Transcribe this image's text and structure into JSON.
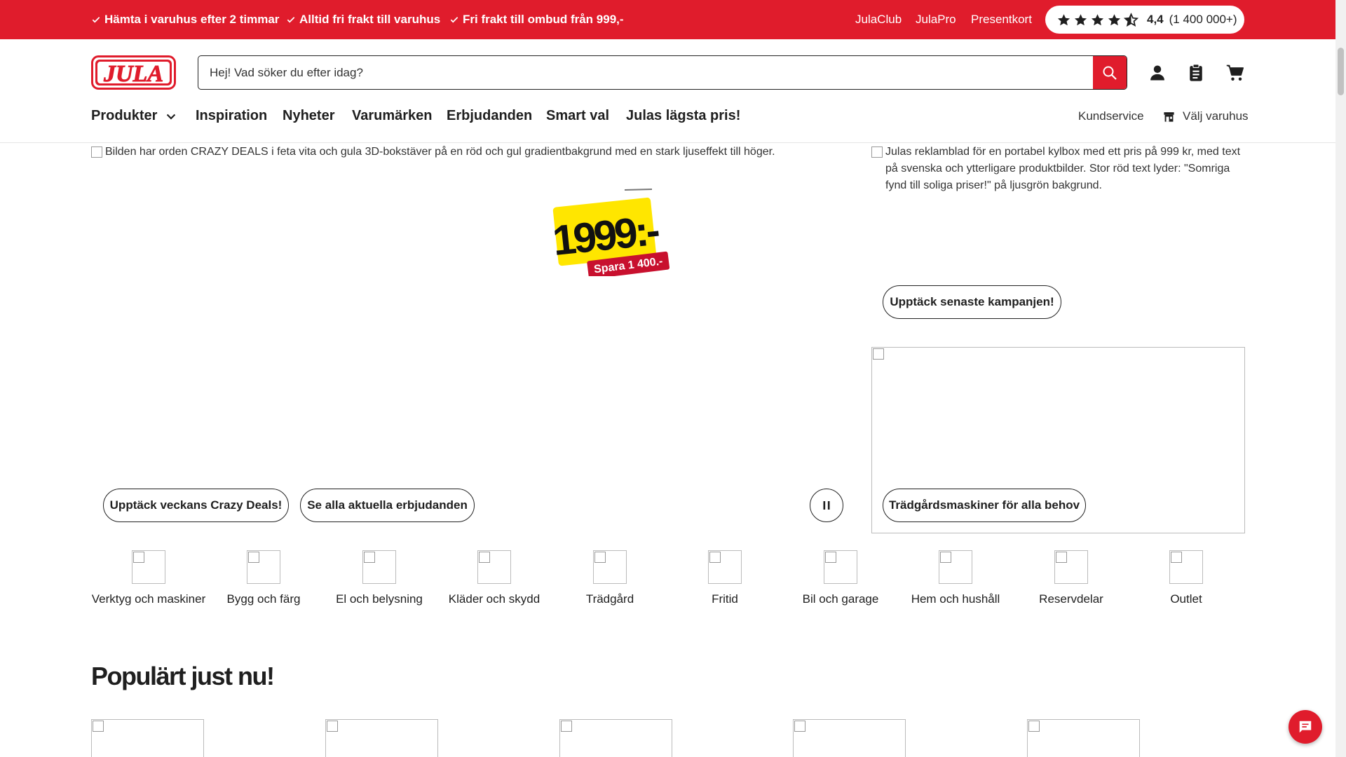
{
  "colors": {
    "brand_red": "#e01c2c",
    "text": "#1f1f1f"
  },
  "topbar": {
    "usps": [
      "Hämta i varuhus efter 2 timmar",
      "Alltid fri frakt till varuhus",
      "Fri frakt till ombud från 999,-"
    ],
    "links": [
      "JulaClub",
      "JulaPro",
      "Presentkort"
    ],
    "rating": {
      "score": "4,4",
      "count": "(1 400 000+)",
      "stars": 4.5,
      "max": 5
    }
  },
  "header": {
    "logo_text": "JULA",
    "search_placeholder": "Hej! Vad söker du efter idag?",
    "icons": [
      "user-icon",
      "clipboard-list-icon",
      "cart-icon"
    ]
  },
  "nav": {
    "items": [
      "Produkter",
      "Inspiration",
      "Nyheter",
      "Varumärken",
      "Erbjudanden",
      "Smart val",
      "Julas lägsta pris!"
    ],
    "right": {
      "service": "Kundservice",
      "store": "Välj varuhus"
    }
  },
  "hero": {
    "main_alt": "Bilden har orden CRAZY DEALS i feta vita och gula 3D-bokstäver på en röd och gul gradientbakgrund med en stark ljuseffekt till höger.",
    "price": "1999:-",
    "save": "Spara 1 400.-",
    "buttons": [
      "Upptäck veckans Crazy Deals!",
      "Se alla aktuella erbjudanden"
    ],
    "side_alt": "Julas reklamblad för en portabel kylbox med ett pris på 999 kr, med text på svenska och ytterligare produktbilder. Stor röd text lyder: \"Somriga fynd till soliga priser!\" på ljusgrön bakgrund.",
    "side_button": "Upptäck senaste kampanjen!",
    "side_button_2": "Trädgårdsmaskiner för alla behov"
  },
  "categories": [
    "Verktyg och maskiner",
    "Bygg och färg",
    "El och belysning",
    "Kläder och skydd",
    "Trädgård",
    "Fritid",
    "Bil och garage",
    "Hem och hushåll",
    "Reservdelar",
    "Outlet"
  ],
  "popular": {
    "title": "Populärt just nu!"
  }
}
